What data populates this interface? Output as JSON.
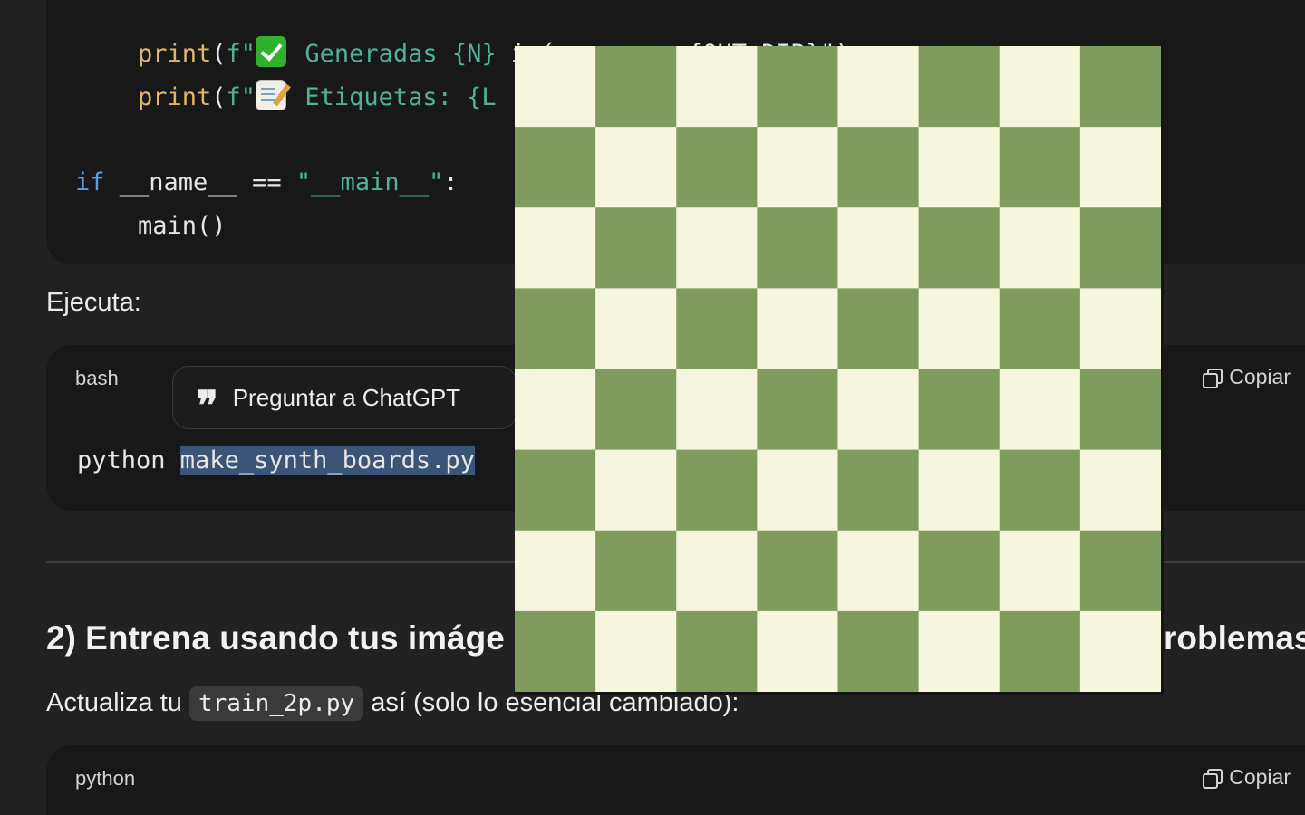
{
  "code_top": {
    "line1": {
      "fn": "print",
      "open": "(",
      "prefix": "f\"",
      "text": " Generadas ",
      "var": "{N}",
      "rest": " imágenes en {OUT_DIR}\")"
    },
    "line2": {
      "fn": "print",
      "open": "(",
      "prefix": "f\"",
      "text": " Etiquetas: {L"
    },
    "line3": {
      "kw": "if",
      "mid": " __name__ == ",
      "str": "\"__main__\"",
      "end": ":"
    },
    "line4": {
      "text": "main()"
    }
  },
  "section1": {
    "label": "Ejecuta:"
  },
  "bash_block": {
    "lang": "bash",
    "copy_label": "Copiar",
    "cmd": "python ",
    "arg": "make_synth_boards.py"
  },
  "ask_popup": {
    "label": "Preguntar a ChatGPT"
  },
  "heading2": {
    "left": "2) Entrena usando tus imáge",
    "right": "roblemas"
  },
  "paragraph2": {
    "before": "Actualiza tu ",
    "code": "train_2p.py",
    "after": " así (solo lo esencial cambiado):"
  },
  "python_block": {
    "lang": "python",
    "copy_label": "Copiar"
  },
  "board": {
    "rows": 8,
    "cols": 8,
    "light_color": "#f6f6df",
    "dark_color": "#7f9b5d"
  },
  "icons": {
    "check": "check-emoji-icon",
    "memo": "memo-emoji-icon",
    "quote": "quote-icon",
    "copy": "copy-icon"
  }
}
